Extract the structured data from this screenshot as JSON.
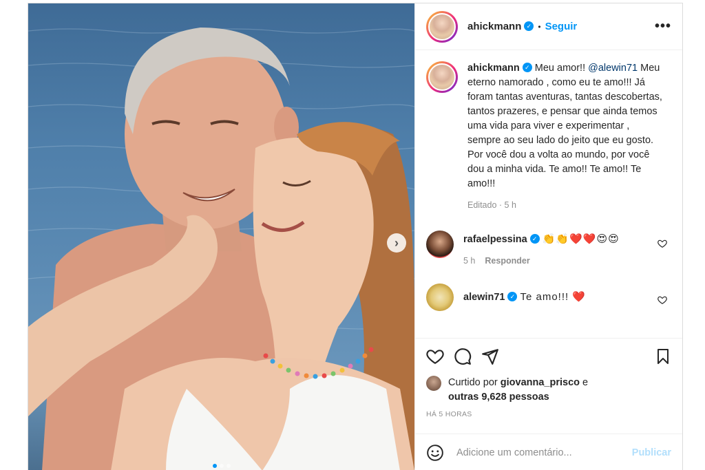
{
  "post": {
    "author": {
      "username": "ahickmann",
      "verified": true,
      "follow_label": "Seguir",
      "bullet": "•"
    },
    "more_label": "•••",
    "caption": {
      "username": "ahickmann",
      "lead": "Meu amor!! ",
      "mention": "@alewin71",
      "body": "Meu eterno namorado , como eu te amo!!! Já foram tantas aventuras, tantas descobertas, tantos prazeres, e pensar que ainda temos uma vida para viver e experimentar , sempre ao seu lado do jeito que eu gosto. Por você dou a volta ao mundo, por você dou a minha vida. Te amo!! Te amo!! Te amo!!!",
      "edited": "Editado",
      "separator": " · ",
      "time": "5 h"
    },
    "comments": [
      {
        "username": "rafaelpessina",
        "verified": true,
        "text": "👏👏❤️❤️😍😍",
        "time": "5 h",
        "reply_label": "Responder",
        "like_icon": "heart-outline"
      },
      {
        "username": "alewin71",
        "verified": true,
        "text": "Te amo!!! ❤️",
        "like_icon": "heart-outline"
      }
    ],
    "likes": {
      "prefix": "Curtido por ",
      "user": "giovanna_prisco",
      "conj": " e",
      "others": "outras 9,628 pessoas"
    },
    "timestamp": "HÁ 5 HORAS",
    "add_comment": {
      "placeholder": "Adicione um comentário...",
      "publish_label": "Publicar"
    },
    "carousel": {
      "next_glyph": "›",
      "slides": 3,
      "active": 0
    }
  },
  "colors": {
    "accent": "#0095f6",
    "mention": "#00376b",
    "muted": "#8e8e8e",
    "publish_disabled": "#b2dffc"
  }
}
